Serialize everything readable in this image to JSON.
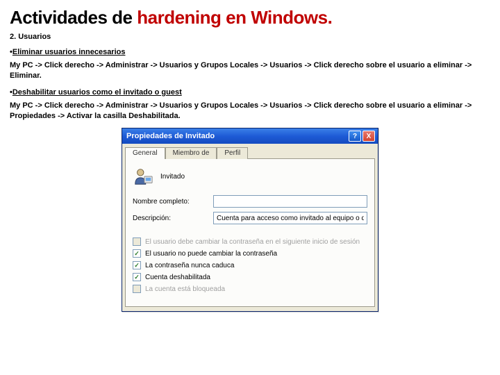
{
  "title": {
    "part1": "Actividades de ",
    "part2": "hardening en Windows",
    "dot": "."
  },
  "section": "2. Usuarios",
  "bullet1": "Eliminar usuarios innecesarios",
  "path1": "My PC -> Click derecho -> Administrar -> Usuarios y Grupos Locales -> Usuarios -> Click derecho sobre el usuario a eliminar -> Eliminar.",
  "bullet2": "Deshabilitar usuarios como el invitado o guest",
  "path2": "My PC -> Click derecho -> Administrar -> Usuarios y Grupos Locales -> Usuarios -> Click derecho sobre el usuario a eliminar -> Propiedades -> Activar la casilla Deshabilitada.",
  "dialog": {
    "title": "Propiedades de Invitado",
    "help": "?",
    "close": "X",
    "tabs": {
      "general": "General",
      "miembro": "Miembro de",
      "perfil": "Perfil"
    },
    "username": "Invitado",
    "labels": {
      "fullname": "Nombre completo:",
      "description": "Descripción:"
    },
    "fields": {
      "fullname": "",
      "description": "Cuenta para acceso como invitado al equipo o dominio"
    },
    "checks": {
      "changepw": "El usuario debe cambiar la contraseña en el siguiente inicio de sesión",
      "cantchange": "El usuario no puede cambiar la contraseña",
      "neverexpire": "La contraseña nunca caduca",
      "disabled": "Cuenta deshabilitada",
      "locked": "La cuenta está bloqueada"
    }
  }
}
